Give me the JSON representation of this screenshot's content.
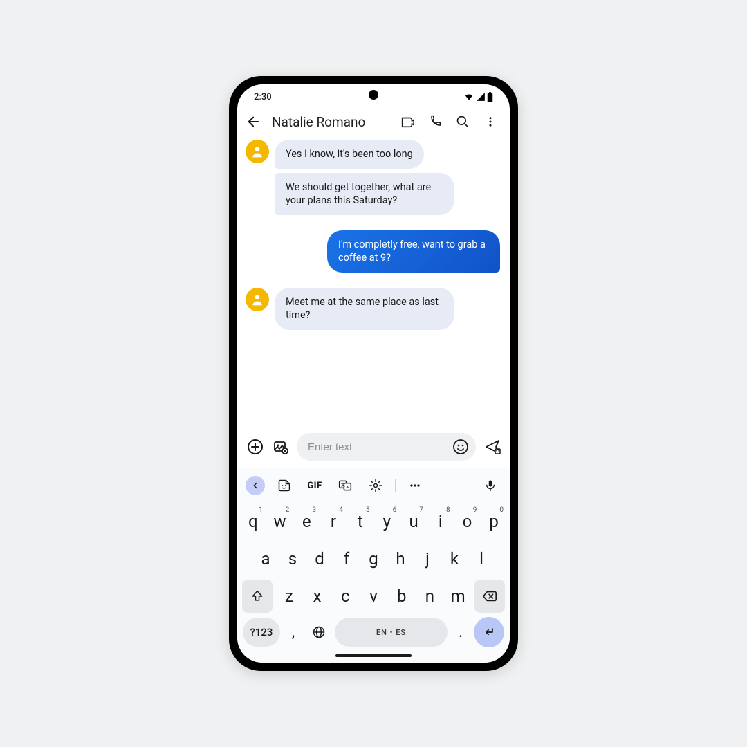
{
  "status": {
    "time": "2:30"
  },
  "header": {
    "contact_name": "Natalie Romano"
  },
  "messages": {
    "in1": "Yes I know, it's been too long",
    "in2": "We should get together, what are your plans this Saturday?",
    "out1": "I'm completly free, want to grab a coffee at 9?",
    "in3": "Meet me at the same place as last time?"
  },
  "compose": {
    "placeholder": "Enter text"
  },
  "keyboard": {
    "gif_label": "GIF",
    "row1": {
      "k0": "q",
      "k1": "w",
      "k2": "e",
      "k3": "r",
      "k4": "t",
      "k5": "y",
      "k6": "u",
      "k7": "i",
      "k8": "o",
      "k9": "p"
    },
    "row1_sup": {
      "k0": "1",
      "k1": "2",
      "k2": "3",
      "k3": "4",
      "k4": "5",
      "k5": "6",
      "k6": "7",
      "k7": "8",
      "k8": "9",
      "k9": "0"
    },
    "row2": {
      "k0": "a",
      "k1": "s",
      "k2": "d",
      "k3": "f",
      "k4": "g",
      "k5": "h",
      "k6": "j",
      "k7": "k",
      "k8": "l"
    },
    "row3": {
      "k0": "z",
      "k1": "x",
      "k2": "c",
      "k3": "v",
      "k4": "b",
      "k5": "n",
      "k6": "m"
    },
    "sym_label": "?123",
    "comma": ",",
    "period": ".",
    "space_label": "EN • ES"
  }
}
